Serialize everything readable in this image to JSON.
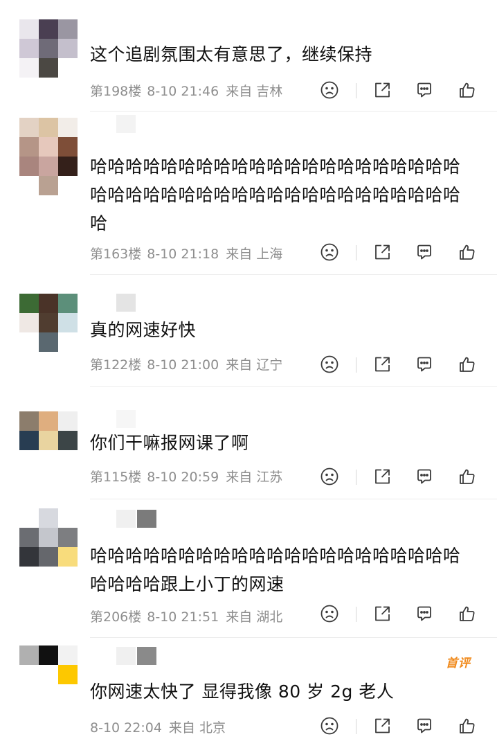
{
  "comments": [
    {
      "text": "这个追剧氛围太有意思了，继续保持",
      "floor": "第198楼",
      "time": "8-10 21:46",
      "from": "来自",
      "location": "吉林",
      "avatar_colors": [
        "#e9e6ec",
        "#4a3f52",
        "#9a96a2",
        "#cfc8d6",
        "#6f6b78",
        "#c4bfcc",
        "#f4f2f5",
        "#4b4843",
        "#ffffff"
      ],
      "nick_colors": []
    },
    {
      "text": "哈哈哈哈哈哈哈哈哈哈哈哈哈哈哈哈哈哈哈哈哈哈哈哈哈哈哈哈哈哈哈哈哈哈哈哈哈哈哈哈哈哈哈",
      "floor": "第163楼",
      "time": "8-10 21:18",
      "from": "来自",
      "location": "上海",
      "avatar_colors": [
        "#e3d2c4",
        "#dcc4a4",
        "#f2ede8",
        "#b59587",
        "#e6c8bc",
        "#7e4e38",
        "#a9857e",
        "#c9a59f",
        "#34201a",
        "#ffffff",
        "#b9a192",
        "#ffffff"
      ],
      "nick_colors": [
        "#f3f3f3"
      ]
    },
    {
      "text": "真的网速好快",
      "floor": "第122楼",
      "time": "8-10 21:00",
      "from": "来自",
      "location": "辽宁",
      "avatar_colors": [
        "#3c6a34",
        "#4a3328",
        "#5c8f7a",
        "#efe8e4",
        "#503d30",
        "#cfe0e6",
        "#ffffff",
        "#5a6870",
        "#ffffff"
      ],
      "nick_colors": [
        "#e4e4e4"
      ]
    },
    {
      "text": "你们干嘛报网课了啊",
      "floor": "第115楼",
      "time": "8-10 20:59",
      "from": "来自",
      "location": "江苏",
      "avatar_colors": [
        "#8c7d6c",
        "#dfae7f",
        "#efefef",
        "#283d52",
        "#e9d4a0",
        "#3c4547",
        "#ffffff",
        "#ffffff",
        "#ffffff"
      ],
      "nick_colors": [
        "#f6f6f6"
      ]
    },
    {
      "text": "哈哈哈哈哈哈哈哈哈哈哈哈哈哈哈哈哈哈哈哈哈哈哈哈哈跟上小丁的网速",
      "floor": "第206楼",
      "time": "8-10 21:51",
      "from": "来自",
      "location": "湖北",
      "avatar_colors": [
        "#ffffff",
        "#d7d9df",
        "#ffffff",
        "#6b6d72",
        "#c4c6cc",
        "#7d7e81",
        "#33353a",
        "#65676c",
        "#f8dc7c"
      ],
      "nick_colors": [
        "#f0f0f0",
        "#7b7b7b"
      ]
    },
    {
      "text": "你网速太快了 显得我像 80 岁 2g 老人",
      "floor": "",
      "time": "8-10 22:04",
      "from": "来自",
      "location": "北京",
      "avatar_colors": [
        "#b0b0b0",
        "#111111",
        "#f2f2f2",
        "#ffffff",
        "#ffffff",
        "#fdc800",
        "#ffffff",
        "#ffffff",
        "#ffffff"
      ],
      "nick_colors": [
        "#f0f0f0",
        "#8a8a8a"
      ]
    }
  ],
  "badge_first_comment": "首评",
  "icons": {
    "dislike": "frown-face-icon",
    "share": "share-arrow-icon",
    "reply": "comment-bubble-icon",
    "like": "thumbs-up-icon"
  },
  "colors": {
    "text": "#111111",
    "meta": "#8e8e8e",
    "badge": "#f08a1c",
    "divider": "#ececec"
  }
}
